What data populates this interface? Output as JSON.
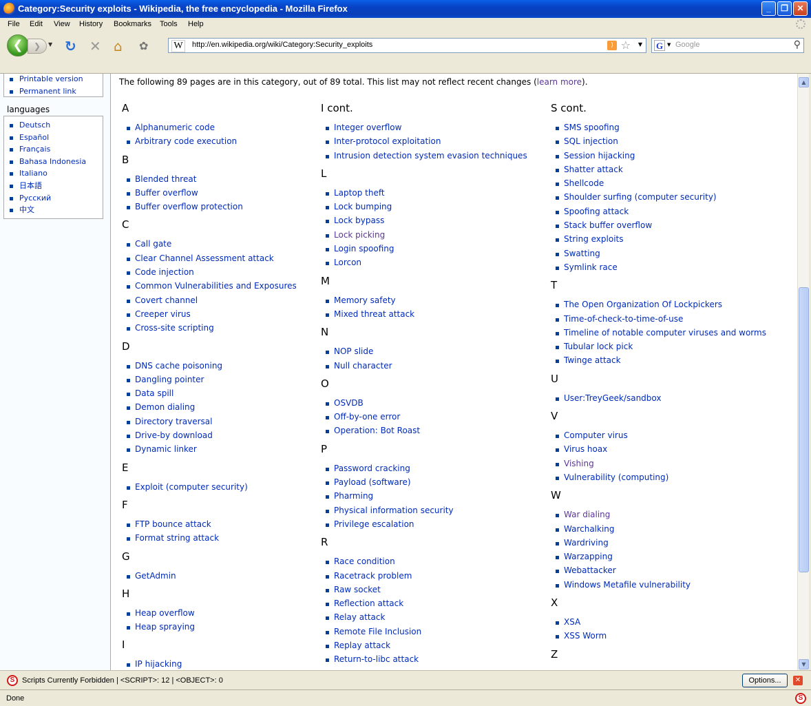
{
  "window": {
    "title": "Category:Security exploits - Wikipedia, the free encyclopedia - Mozilla Firefox",
    "controls": {
      "minimize": "_",
      "maximize": "❐",
      "close": "✕"
    }
  },
  "menu": [
    "File",
    "Edit",
    "View",
    "History",
    "Bookmarks",
    "Tools",
    "Help"
  ],
  "toolbar": {
    "url": "http://en.wikipedia.org/wiki/Category:Security_exploits",
    "site_icon": "W",
    "search_placeholder": "Google",
    "search_engine_icon": "G",
    "back_glyph": "❮",
    "forward_glyph": "❯",
    "reload_glyph": "↻",
    "stop_glyph": "✕",
    "home_glyph": "⌂",
    "addon_glyph": "✿",
    "rss_glyph": ")",
    "star_glyph": "☆",
    "dropdown_glyph": "▼",
    "search_glyph": "⚲"
  },
  "sidebar": {
    "toolbox": [
      "Printable version",
      "Permanent link"
    ],
    "languages_heading": "languages",
    "languages": [
      "Deutsch",
      "Español",
      "Français",
      "Bahasa Indonesia",
      "Italiano",
      "日本語",
      "Русский",
      "中文"
    ]
  },
  "page": {
    "intro": "The following 89 pages are in this category, out of 89 total. This list may not reflect recent changes (",
    "intro_link": "learn more",
    "intro_end": ").",
    "col1": [
      {
        "letter": "A",
        "items": [
          "Alphanumeric code",
          "Arbitrary code execution"
        ]
      },
      {
        "letter": "B",
        "items": [
          "Blended threat",
          "Buffer overflow",
          "Buffer overflow protection"
        ]
      },
      {
        "letter": "C",
        "items": [
          "Call gate",
          "Clear Channel Assessment attack",
          "Code injection",
          "Common Vulnerabilities and Exposures",
          "Covert channel",
          "Creeper virus",
          "Cross-site scripting"
        ]
      },
      {
        "letter": "D",
        "items": [
          "DNS cache poisoning",
          "Dangling pointer",
          "Data spill",
          "Demon dialing",
          "Directory traversal",
          "Drive-by download",
          "Dynamic linker"
        ]
      },
      {
        "letter": "E",
        "items": [
          "Exploit (computer security)"
        ]
      },
      {
        "letter": "F",
        "items": [
          "FTP bounce attack",
          "Format string attack"
        ]
      },
      {
        "letter": "G",
        "items": [
          "GetAdmin"
        ]
      },
      {
        "letter": "H",
        "items": [
          "Heap overflow",
          "Heap spraying"
        ]
      },
      {
        "letter": "I",
        "items": [
          "IP hijacking"
        ]
      }
    ],
    "col2": [
      {
        "letter": "I cont.",
        "items": [
          "Integer overflow",
          "Inter-protocol exploitation",
          "Intrusion detection system evasion techniques"
        ]
      },
      {
        "letter": "L",
        "items": [
          "Laptop theft",
          "Lock bumping",
          "Lock bypass",
          "Lock picking",
          "Login spoofing",
          "Lorcon"
        ]
      },
      {
        "letter": "M",
        "items": [
          "Memory safety",
          "Mixed threat attack"
        ]
      },
      {
        "letter": "N",
        "items": [
          "NOP slide",
          "Null character"
        ]
      },
      {
        "letter": "O",
        "items": [
          "OSVDB",
          "Off-by-one error",
          "Operation: Bot Roast"
        ]
      },
      {
        "letter": "P",
        "items": [
          "Password cracking",
          "Payload (software)",
          "Pharming",
          "Physical information security",
          "Privilege escalation"
        ]
      },
      {
        "letter": "R",
        "items": [
          "Race condition",
          "Racetrack problem",
          "Raw socket",
          "Reflection attack",
          "Relay attack",
          "Remote File Inclusion",
          "Replay attack",
          "Return-to-libc attack"
        ]
      }
    ],
    "col3": [
      {
        "letter": "S cont.",
        "items": [
          "SMS spoofing",
          "SQL injection",
          "Session hijacking",
          "Shatter attack",
          "Shellcode",
          "Shoulder surfing (computer security)",
          "Spoofing attack",
          "Stack buffer overflow",
          "String exploits",
          "Swatting",
          "Symlink race"
        ]
      },
      {
        "letter": "T",
        "items": [
          "The Open Organization Of Lockpickers",
          "Time-of-check-to-time-of-use",
          "Timeline of notable computer viruses and worms",
          "Tubular lock pick",
          "Twinge attack"
        ]
      },
      {
        "letter": "U",
        "items": [
          "User:TreyGeek/sandbox"
        ]
      },
      {
        "letter": "V",
        "items": [
          "Computer virus",
          "Virus hoax",
          "Vishing",
          "Vulnerability (computing)"
        ]
      },
      {
        "letter": "W",
        "items": [
          "War dialing",
          "Warchalking",
          "Wardriving",
          "Warzapping",
          "Webattacker",
          "Windows Metafile vulnerability"
        ]
      },
      {
        "letter": "X",
        "items": [
          "XSA",
          "XSS Worm"
        ]
      },
      {
        "letter": "Z",
        "items": []
      }
    ],
    "visited": [
      "Lock picking",
      "Vishing",
      "War dialing"
    ]
  },
  "scrollbar": {
    "up_glyph": "▲",
    "down_glyph": "▼"
  },
  "noscript": {
    "icon": "S",
    "message": "Scripts Currently Forbidden | <SCRIPT>: 12 | <OBJECT>: 0",
    "options_label": "Options...",
    "close_glyph": "✕"
  },
  "status": {
    "text": "Done"
  },
  "colors": {
    "link": "#002bb8",
    "visited": "#5a3696",
    "titlebar": "#0842c4"
  }
}
